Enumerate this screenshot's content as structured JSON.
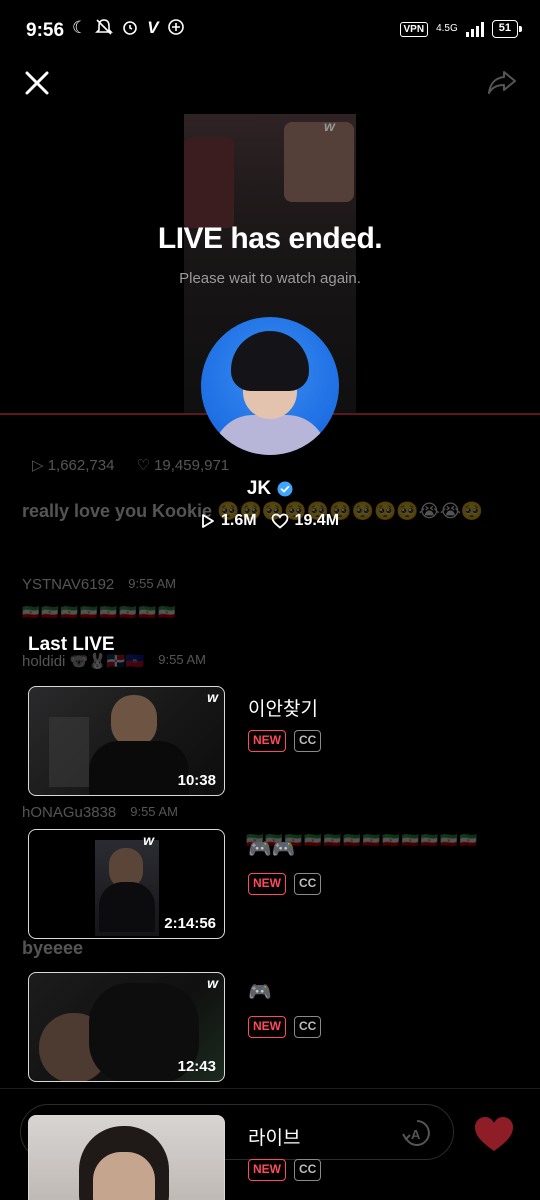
{
  "status_bar": {
    "time": "9:56",
    "left_icons": [
      "moon-icon",
      "bell-off-icon",
      "alarm-icon",
      "v-icon",
      "plus-circle-icon"
    ],
    "vpn": "VPN",
    "network": "4.5G",
    "battery": "51"
  },
  "live": {
    "title": "LIVE has ended.",
    "subtitle": "Please wait to watch again."
  },
  "chat_bg": {
    "views": "1,662,734",
    "likes": "19,459,971",
    "message1": "really love you Kookie 🥺🥺🥺🥺🥺🥺🥺🥺🥺😭😭🥺",
    "user1": "YSTNAV6192",
    "time1": "9:55 AM",
    "flags1": "🇮🇷🇮🇷🇮🇷🇮🇷🇮🇷🇮🇷🇮🇷🇮🇷",
    "user2": "holdidi 🐨🐰🇩🇴🇭🇹",
    "time2": "9:55 AM",
    "user3": "hONAGu3838",
    "time3": "9:55 AM",
    "flags3": "🇮🇷🇮🇷🇮🇷🇮🇷🇮🇷🇮🇷🇮🇷🇮🇷🇮🇷🇮🇷🇮🇷🇮🇷",
    "message3": "byeeee"
  },
  "profile": {
    "name": "JK",
    "views": "1.6M",
    "likes": "19.4M"
  },
  "last_live_label": "Last LIVE",
  "videos": [
    {
      "title": "이안찾기",
      "duration": "10:38",
      "badge_new": "NEW",
      "badge_cc": "CC"
    },
    {
      "title": "🎮🎮",
      "duration": "2:14:56",
      "badge_new": "NEW",
      "badge_cc": "CC"
    },
    {
      "title": "🎮",
      "duration": "12:43",
      "badge_new": "NEW",
      "badge_cc": "CC"
    },
    {
      "title": "라이브",
      "duration": "",
      "badge_new": "NEW",
      "badge_cc": "CC"
    }
  ],
  "colors": {
    "accent_red": "#ff4a5b",
    "verified_blue": "#3ea6ff",
    "heart": "#8e1d28",
    "avatar_bg": "#2173e6"
  }
}
